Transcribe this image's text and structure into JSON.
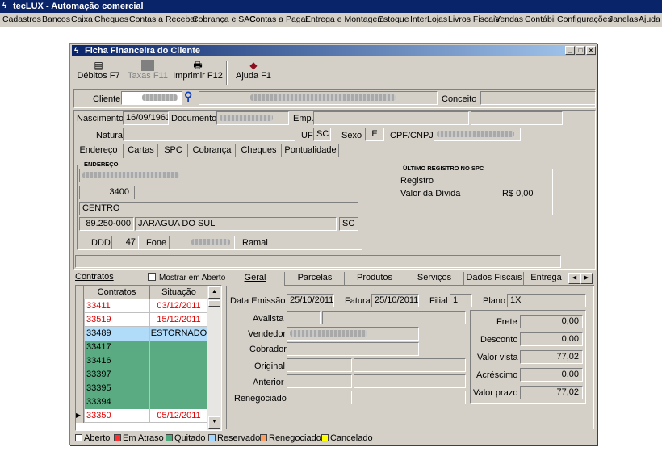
{
  "app": {
    "title": "tecLUX - Automação comercial"
  },
  "menu": [
    "Cadastros",
    "Bancos",
    "Caixa",
    "Cheques",
    "Contas a Receber",
    "Cobrança e SAC",
    "Contas a Pagar",
    "Entrega e Montagem",
    "Estoque",
    "InterLojas",
    "Livros Fiscais",
    "Vendas",
    "Contábil",
    "Configurações",
    "Janelas",
    "Ajuda"
  ],
  "window": {
    "title": "Ficha Financeira do Cliente",
    "min": "_",
    "max": "□",
    "close": "×"
  },
  "toolbar": {
    "debitos": "Débitos F7",
    "taxas": "Taxas F11",
    "imprimir": "Imprimir F12",
    "ajuda": "Ajuda F1"
  },
  "client": {
    "cliente_label": "Cliente",
    "conceito_label": "Conceito",
    "nascimento_label": "Nascimento",
    "nascimento": "16/09/1961",
    "documento_label": "Documento",
    "emp_label": "Emp.",
    "natural_label": "Natural",
    "uf_label": "UF",
    "uf": "SC",
    "sexo_label": "Sexo",
    "sexo": "E",
    "cpf_label": "CPF/CNPJ"
  },
  "tabs_top": [
    "Endereço",
    "Cartas",
    "SPC",
    "Cobrança",
    "Cheques",
    "Pontualidade"
  ],
  "endereco": {
    "group_title": "ENDEREÇO",
    "numero": "3400",
    "bairro": "CENTRO",
    "cep": "89.250-000",
    "cidade": "JARAGUA DO SUL",
    "uf": "SC",
    "ddd_label": "DDD",
    "ddd": "47",
    "fone_label": "Fone",
    "ramal_label": "Ramal"
  },
  "spc": {
    "group_title": "ÚLTIMO REGISTRO NO SPC",
    "registro_label": "Registro",
    "valor_label": "Valor da Dívida",
    "valor": "R$ 0,00"
  },
  "contratos": {
    "label": "Contratos",
    "mostrar_label": "Mostrar em Aberto",
    "col_contratos": "Contratos",
    "col_situacao": "Situação",
    "rows": [
      {
        "num": "33411",
        "sit": "03/12/2011",
        "status": "atraso"
      },
      {
        "num": "33519",
        "sit": "15/12/2011",
        "status": "atraso"
      },
      {
        "num": "33489",
        "sit": "ESTORNADO",
        "status": "reservado"
      },
      {
        "num": "33417",
        "sit": "",
        "status": "quitado"
      },
      {
        "num": "33416",
        "sit": "",
        "status": "quitado"
      },
      {
        "num": "33397",
        "sit": "",
        "status": "quitado"
      },
      {
        "num": "33395",
        "sit": "",
        "status": "quitado"
      },
      {
        "num": "33394",
        "sit": "",
        "status": "quitado"
      },
      {
        "num": "33350",
        "sit": "05/12/2011",
        "status": "atraso"
      }
    ]
  },
  "tabs_bottom": [
    "Geral",
    "Parcelas",
    "Produtos",
    "Serviços",
    "Dados Fiscais",
    "Entrega"
  ],
  "geral": {
    "data_emissao_label": "Data Emissão",
    "data_emissao": "25/10/2011",
    "fatura_label": "Fatura",
    "fatura": "25/10/2011",
    "filial_label": "Filial",
    "filial": "1",
    "plano_label": "Plano",
    "plano": "1X",
    "avalista_label": "Avalista",
    "vendedor_label": "Vendedor",
    "cobrador_label": "Cobrador",
    "original_label": "Original",
    "anterior_label": "Anterior",
    "renegociado_label": "Renegociado"
  },
  "totais": {
    "frete_label": "Frete",
    "frete": "0,00",
    "desconto_label": "Desconto",
    "desconto": "0,00",
    "valor_vista_label": "Valor vista",
    "valor_vista": "77,02",
    "acrescimo_label": "Acréscimo",
    "acrescimo": "0,00",
    "valor_prazo_label": "Valor prazo",
    "valor_prazo": "77,02"
  },
  "legend": [
    {
      "label": "Aberto",
      "color": "#ffffff"
    },
    {
      "label": "Em Atraso",
      "color": "#ff3030"
    },
    {
      "label": "Quitado",
      "color": "#4caa7c"
    },
    {
      "label": "Reservado",
      "color": "#a6d8ff"
    },
    {
      "label": "Renegociado",
      "color": "#ffa060"
    },
    {
      "label": "Cancelado",
      "color": "#ffff00"
    }
  ],
  "colors": {
    "atraso_text": "#e00000",
    "quitado_bg": "#5aab82",
    "reservado_bg": "#b0dcfa"
  }
}
